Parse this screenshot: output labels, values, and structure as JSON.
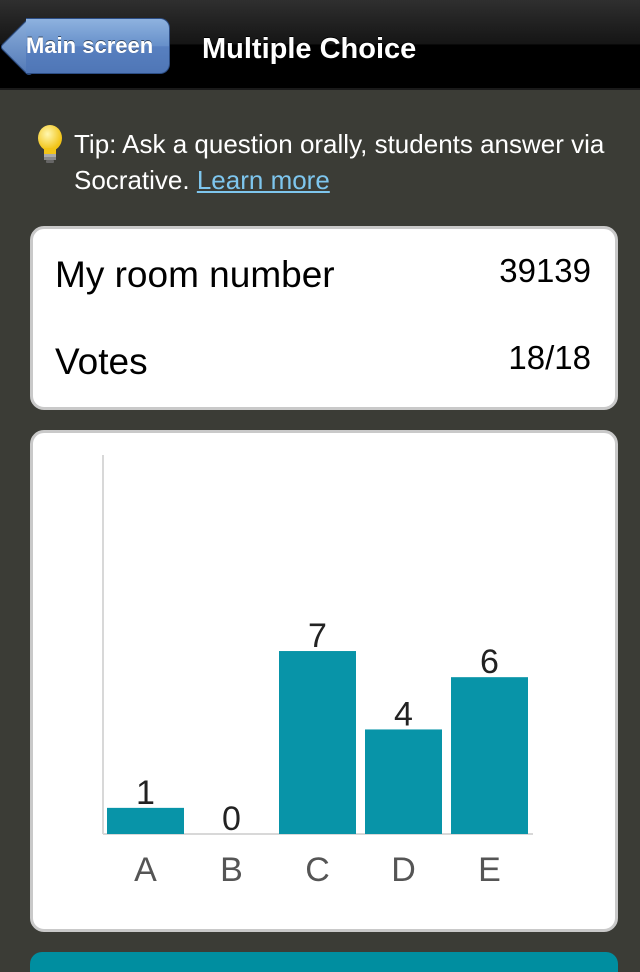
{
  "navbar": {
    "back_label": "Main screen",
    "title": "Multiple Choice"
  },
  "tip": {
    "text": "Tip: Ask a question orally, students answer via Socrative.",
    "link": "Learn more"
  },
  "info": {
    "room_label": "My room number",
    "room_value": "39139",
    "votes_label": "Votes",
    "votes_value": "18/18"
  },
  "colors": {
    "bar": "#0894a8",
    "back_button": "#5f87c4",
    "link": "#7ec6ee"
  },
  "icons": {
    "tip": "lightbulb-icon"
  },
  "chart_data": {
    "type": "bar",
    "categories": [
      "A",
      "B",
      "C",
      "D",
      "E"
    ],
    "values": [
      1,
      0,
      7,
      4,
      6
    ],
    "title": "",
    "xlabel": "",
    "ylabel": "",
    "ylim": [
      0,
      14.5
    ],
    "grid": false
  }
}
